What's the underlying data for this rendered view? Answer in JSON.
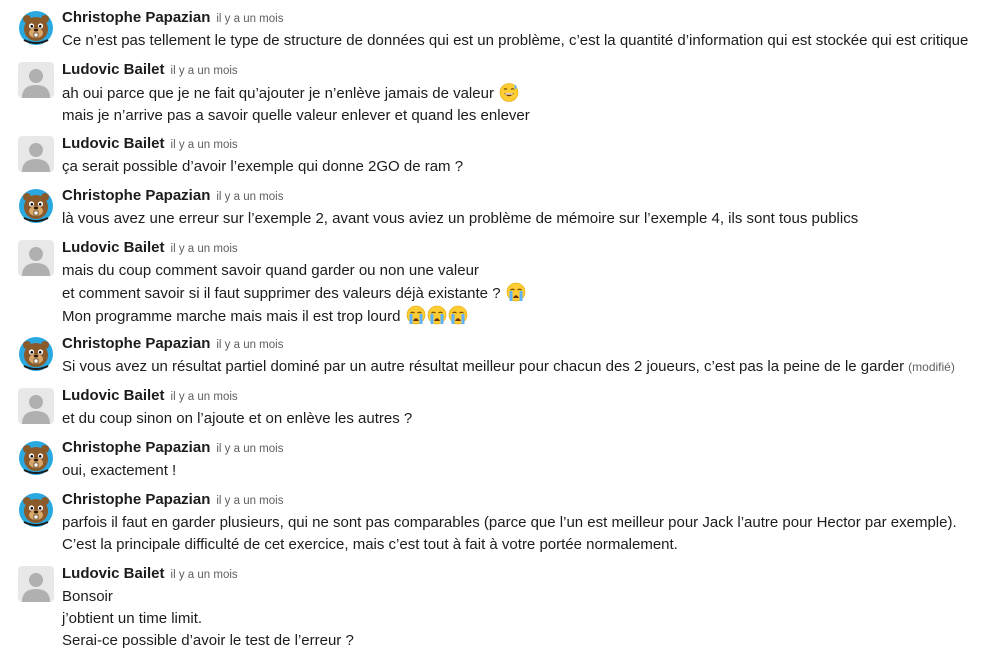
{
  "messages": [
    {
      "author": "Christophe Papazian",
      "time": "il y a un mois",
      "avatar": "beaver-avatar",
      "lines": [
        "Ce n’est pas tellement le type de structure de données qui est un problème, c’est la quantité d’information qui est stockée qui est critique"
      ]
    },
    {
      "author": "Ludovic Bailet",
      "time": "il y a un mois",
      "avatar": "default-user-avatar",
      "lines": [
        "ah oui parce que je ne fait qu’ajouter je n’enlève jamais de valeur",
        "mais je n’arrive pas a savoir quelle valeur enlever et quand les enlever"
      ],
      "emoji_line1": "grinning-sweat-emoji"
    },
    {
      "author": "Ludovic Bailet",
      "time": "il y a un mois",
      "avatar": "default-user-avatar",
      "lines": [
        "ça serait possible d’avoir l’exemple qui donne 2GO de ram ?"
      ]
    },
    {
      "author": "Christophe Papazian",
      "time": "il y a un mois",
      "avatar": "beaver-avatar",
      "lines": [
        "là vous avez une erreur sur l’exemple 2, avant vous aviez un problème de mémoire sur l’exemple 4, ils sont tous publics"
      ]
    },
    {
      "author": "Ludovic Bailet",
      "time": "il y a un mois",
      "avatar": "default-user-avatar",
      "lines": [
        "mais du coup comment savoir quand garder ou non une valeur",
        "et comment savoir si il faut supprimer des valeurs déjà existante ?",
        "Mon programme marche mais mais il est trop lourd"
      ],
      "emoji_line2": "loudly-crying-emoji",
      "emoji_line3": [
        "loudly-crying-emoji",
        "loudly-crying-emoji",
        "loudly-crying-emoji"
      ]
    },
    {
      "author": "Christophe Papazian",
      "time": "il y a un mois",
      "avatar": "beaver-avatar",
      "lines": [
        "Si vous avez un résultat partiel dominé par un autre résultat meilleur pour chacun des 2 joueurs, c’est pas la peine de le garder"
      ],
      "edited": "(modifié)"
    },
    {
      "author": "Ludovic Bailet",
      "time": "il y a un mois",
      "avatar": "default-user-avatar",
      "lines": [
        "et du coup sinon on l’ajoute et on enlève les autres ?"
      ]
    },
    {
      "author": "Christophe Papazian",
      "time": "il y a un mois",
      "avatar": "beaver-avatar",
      "lines": [
        "oui, exactement !"
      ]
    },
    {
      "author": "Christophe Papazian",
      "time": "il y a un mois",
      "avatar": "beaver-avatar",
      "lines": [
        "parfois il faut en garder plusieurs, qui ne sont pas comparables (parce que l’un est meilleur pour Jack l’autre pour Hector par exemple). C’est la principale difficulté de cet exercice, mais c’est tout à fait à votre portée normalement."
      ]
    },
    {
      "author": "Ludovic Bailet",
      "time": "il y a un mois",
      "avatar": "default-user-avatar",
      "lines": [
        "Bonsoir",
        "j’obtient un time limit.",
        "Serai-ce possible d’avoir le test de l’erreur ?"
      ]
    }
  ]
}
